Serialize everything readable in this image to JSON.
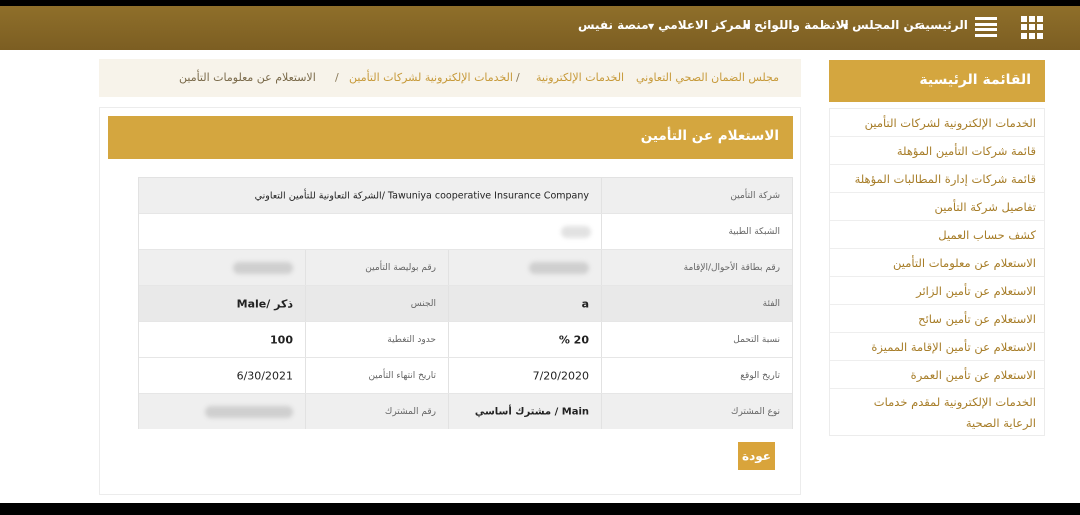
{
  "navbar": {
    "items": [
      "الرئيسية",
      "عن المجلس",
      "الانظمة واللوائح",
      "المركز الاعلامي",
      "منصة نفيس"
    ]
  },
  "breadcrumb": {
    "items": [
      "مجلس الضمان الصحي التعاوني",
      "الخدمات الإلكترونية",
      "الخدمات الإلكترونية لشركات التأمين",
      "الاستعلام عن معلومات التأمين"
    ],
    "separator": "/"
  },
  "sidebar": {
    "title": "القائمة الرئيسية",
    "items": [
      "الخدمات الإلكترونية لشركات التأمين",
      "قائمة شركات التأمين المؤهلة",
      "قائمة شركات إدارة المطالبات المؤهلة",
      "تفاصيل شركة التأمين",
      "كشف حساب العميل",
      "الاستعلام عن معلومات التأمين",
      "الاستعلام عن تأمين الزائر",
      "الاستعلام عن تأمين سائح",
      "الاستعلام عن تأمين الإقامة المميزة",
      "الاستعلام عن تأمين العمرة",
      "الخدمات الإلكترونية لمقدم خدمات الرعاية الصحية"
    ]
  },
  "panel": {
    "title": "الاستعلام عن التأمين",
    "back_label": "عودة"
  },
  "info": {
    "company_label": "شركة التأمين",
    "company_value": "الشركة التعاونية للتأمين التعاوني/ Tawuniya cooperative Insurance Company",
    "network_label": "الشبكة الطبية",
    "id_label": "رقم بطاقة الأحوال/الإقامة",
    "policy_label": "رقم بوليصة التأمين",
    "class_label": "الفئة",
    "class_value": "a",
    "gender_label": "الجنس",
    "gender_value": "Male/ ذكر",
    "deductible_label": "نسبة التحمل",
    "deductible_value": "% 20",
    "coverage_label": "حدود التغطية",
    "coverage_value": "100",
    "start_label": "تاريخ الوقع",
    "start_value": "7/20/2020",
    "end_label": "تاريخ انتهاء التأمين",
    "end_value": "6/30/2021",
    "member_type_label": "نوع المشترك",
    "member_type_value": "مشترك أساسي / Main",
    "member_no_label": "رقم المشترك"
  }
}
